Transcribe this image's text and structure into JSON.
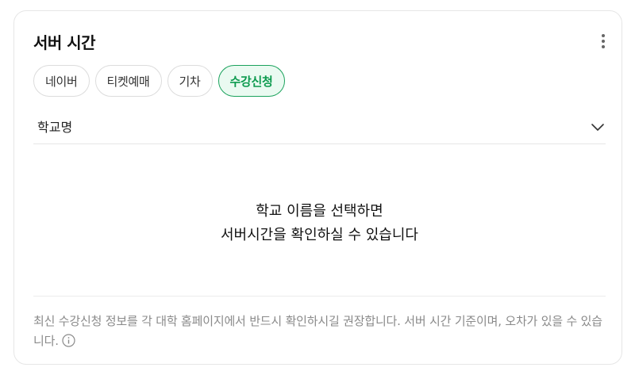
{
  "header": {
    "title": "서버 시간",
    "more_icon": "more-vertical-icon"
  },
  "tabs": [
    {
      "label": "네이버",
      "active": false
    },
    {
      "label": "티켓예매",
      "active": false
    },
    {
      "label": "기차",
      "active": false
    },
    {
      "label": "수강신청",
      "active": true
    }
  ],
  "school_select": {
    "placeholder": "학교명",
    "icon": "chevron-down-icon"
  },
  "empty_state": {
    "line1": "학교 이름을 선택하면",
    "line2": "서버시간을 확인하실 수 있습니다"
  },
  "notice": {
    "text": "최신 수강신청 정보를 각 대학 홈페이지에서 반드시 확인하시길 권장합니다. 서버 시간 기준이며, 오차가 있을 수 있습니다.",
    "icon": "info-icon"
  },
  "colors": {
    "accent": "#0c9a4e",
    "accent_bg": "#eafaf1"
  }
}
